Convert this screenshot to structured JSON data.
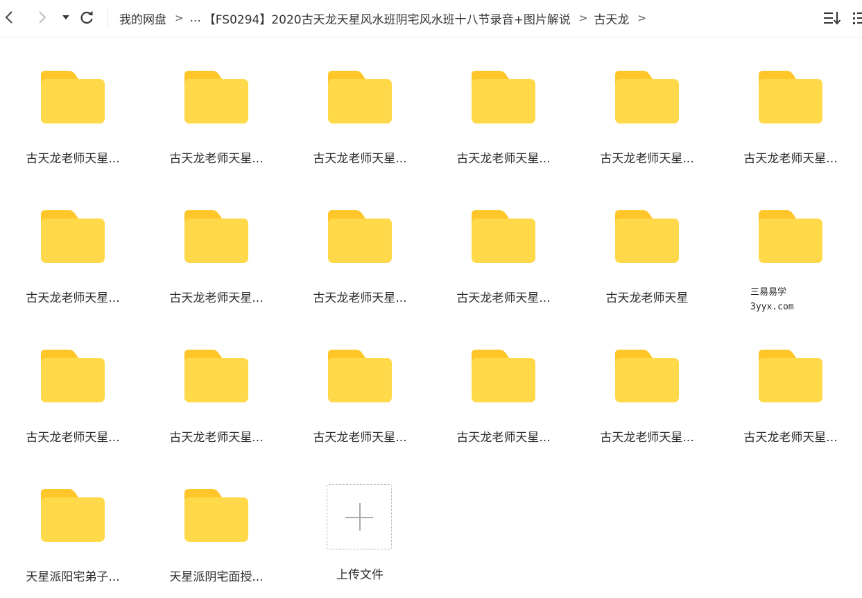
{
  "toolbar": {
    "back_icon": "chevron-left-icon",
    "forward_icon": "chevron-right-icon",
    "dropdown_icon": "caret-down-icon",
    "refresh_icon": "refresh-icon",
    "sort_icon": "sort-list-icon",
    "view_icon": "grid-view-icon"
  },
  "breadcrumb": {
    "items": [
      "我的网盘",
      "...",
      "【FS0294】2020古天龙天星风水班阴宅风水班十八节录音+图片解说",
      "古天龙"
    ],
    "separator": ">"
  },
  "folders": [
    {
      "name": "古天龙老师天星..."
    },
    {
      "name": "古天龙老师天星..."
    },
    {
      "name": "古天龙老师天星..."
    },
    {
      "name": "古天龙老师天星..."
    },
    {
      "name": "古天龙老师天星..."
    },
    {
      "name": "古天龙老师天星..."
    },
    {
      "name": "古天龙老师天星..."
    },
    {
      "name": "古天龙老师天星..."
    },
    {
      "name": "古天龙老师天星..."
    },
    {
      "name": "古天龙老师天星..."
    },
    {
      "name": "古天龙老师天星"
    },
    {
      "name": ""
    },
    {
      "name": "古天龙老师天星..."
    },
    {
      "name": "古天龙老师天星..."
    },
    {
      "name": "古天龙老师天星..."
    },
    {
      "name": "古天龙老师天星..."
    },
    {
      "name": "古天龙老师天星..."
    },
    {
      "name": "古天龙老师天星..."
    },
    {
      "name": "天星派阳宅弟子..."
    },
    {
      "name": "天星派阴宅面授..."
    }
  ],
  "watermark": {
    "line1": "三易易学",
    "line2": "3yyx.com"
  },
  "upload": {
    "label": "上传文件",
    "icon": "plus-icon"
  },
  "colors": {
    "folder_body": "#FFD94A",
    "folder_tab": "#FFC629",
    "icon_stroke": "#444444",
    "disabled_icon": "#bdbdbd"
  }
}
